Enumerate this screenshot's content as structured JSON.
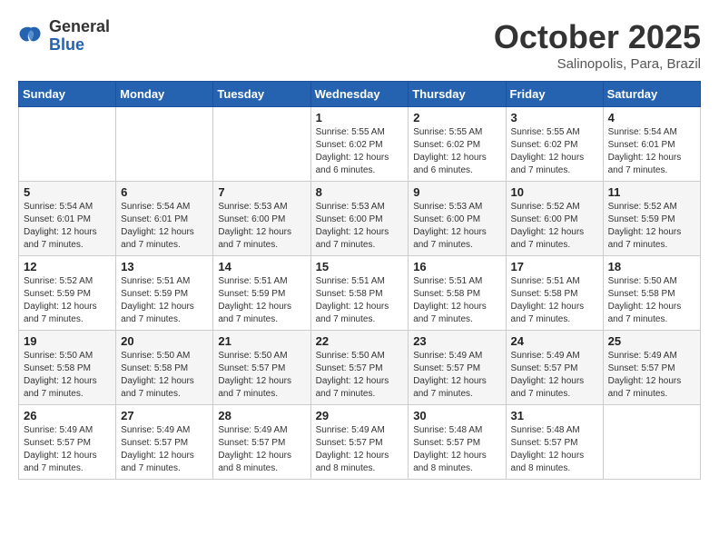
{
  "header": {
    "logo_line1": "General",
    "logo_line2": "Blue",
    "month": "October 2025",
    "location": "Salinopolis, Para, Brazil"
  },
  "weekdays": [
    "Sunday",
    "Monday",
    "Tuesday",
    "Wednesday",
    "Thursday",
    "Friday",
    "Saturday"
  ],
  "weeks": [
    [
      {
        "day": "",
        "info": ""
      },
      {
        "day": "",
        "info": ""
      },
      {
        "day": "",
        "info": ""
      },
      {
        "day": "1",
        "info": "Sunrise: 5:55 AM\nSunset: 6:02 PM\nDaylight: 12 hours and 6 minutes."
      },
      {
        "day": "2",
        "info": "Sunrise: 5:55 AM\nSunset: 6:02 PM\nDaylight: 12 hours and 6 minutes."
      },
      {
        "day": "3",
        "info": "Sunrise: 5:55 AM\nSunset: 6:02 PM\nDaylight: 12 hours and 7 minutes."
      },
      {
        "day": "4",
        "info": "Sunrise: 5:54 AM\nSunset: 6:01 PM\nDaylight: 12 hours and 7 minutes."
      }
    ],
    [
      {
        "day": "5",
        "info": "Sunrise: 5:54 AM\nSunset: 6:01 PM\nDaylight: 12 hours and 7 minutes."
      },
      {
        "day": "6",
        "info": "Sunrise: 5:54 AM\nSunset: 6:01 PM\nDaylight: 12 hours and 7 minutes."
      },
      {
        "day": "7",
        "info": "Sunrise: 5:53 AM\nSunset: 6:00 PM\nDaylight: 12 hours and 7 minutes."
      },
      {
        "day": "8",
        "info": "Sunrise: 5:53 AM\nSunset: 6:00 PM\nDaylight: 12 hours and 7 minutes."
      },
      {
        "day": "9",
        "info": "Sunrise: 5:53 AM\nSunset: 6:00 PM\nDaylight: 12 hours and 7 minutes."
      },
      {
        "day": "10",
        "info": "Sunrise: 5:52 AM\nSunset: 6:00 PM\nDaylight: 12 hours and 7 minutes."
      },
      {
        "day": "11",
        "info": "Sunrise: 5:52 AM\nSunset: 5:59 PM\nDaylight: 12 hours and 7 minutes."
      }
    ],
    [
      {
        "day": "12",
        "info": "Sunrise: 5:52 AM\nSunset: 5:59 PM\nDaylight: 12 hours and 7 minutes."
      },
      {
        "day": "13",
        "info": "Sunrise: 5:51 AM\nSunset: 5:59 PM\nDaylight: 12 hours and 7 minutes."
      },
      {
        "day": "14",
        "info": "Sunrise: 5:51 AM\nSunset: 5:59 PM\nDaylight: 12 hours and 7 minutes."
      },
      {
        "day": "15",
        "info": "Sunrise: 5:51 AM\nSunset: 5:58 PM\nDaylight: 12 hours and 7 minutes."
      },
      {
        "day": "16",
        "info": "Sunrise: 5:51 AM\nSunset: 5:58 PM\nDaylight: 12 hours and 7 minutes."
      },
      {
        "day": "17",
        "info": "Sunrise: 5:51 AM\nSunset: 5:58 PM\nDaylight: 12 hours and 7 minutes."
      },
      {
        "day": "18",
        "info": "Sunrise: 5:50 AM\nSunset: 5:58 PM\nDaylight: 12 hours and 7 minutes."
      }
    ],
    [
      {
        "day": "19",
        "info": "Sunrise: 5:50 AM\nSunset: 5:58 PM\nDaylight: 12 hours and 7 minutes."
      },
      {
        "day": "20",
        "info": "Sunrise: 5:50 AM\nSunset: 5:58 PM\nDaylight: 12 hours and 7 minutes."
      },
      {
        "day": "21",
        "info": "Sunrise: 5:50 AM\nSunset: 5:57 PM\nDaylight: 12 hours and 7 minutes."
      },
      {
        "day": "22",
        "info": "Sunrise: 5:50 AM\nSunset: 5:57 PM\nDaylight: 12 hours and 7 minutes."
      },
      {
        "day": "23",
        "info": "Sunrise: 5:49 AM\nSunset: 5:57 PM\nDaylight: 12 hours and 7 minutes."
      },
      {
        "day": "24",
        "info": "Sunrise: 5:49 AM\nSunset: 5:57 PM\nDaylight: 12 hours and 7 minutes."
      },
      {
        "day": "25",
        "info": "Sunrise: 5:49 AM\nSunset: 5:57 PM\nDaylight: 12 hours and 7 minutes."
      }
    ],
    [
      {
        "day": "26",
        "info": "Sunrise: 5:49 AM\nSunset: 5:57 PM\nDaylight: 12 hours and 7 minutes."
      },
      {
        "day": "27",
        "info": "Sunrise: 5:49 AM\nSunset: 5:57 PM\nDaylight: 12 hours and 7 minutes."
      },
      {
        "day": "28",
        "info": "Sunrise: 5:49 AM\nSunset: 5:57 PM\nDaylight: 12 hours and 8 minutes."
      },
      {
        "day": "29",
        "info": "Sunrise: 5:49 AM\nSunset: 5:57 PM\nDaylight: 12 hours and 8 minutes."
      },
      {
        "day": "30",
        "info": "Sunrise: 5:48 AM\nSunset: 5:57 PM\nDaylight: 12 hours and 8 minutes."
      },
      {
        "day": "31",
        "info": "Sunrise: 5:48 AM\nSunset: 5:57 PM\nDaylight: 12 hours and 8 minutes."
      },
      {
        "day": "",
        "info": ""
      }
    ]
  ]
}
